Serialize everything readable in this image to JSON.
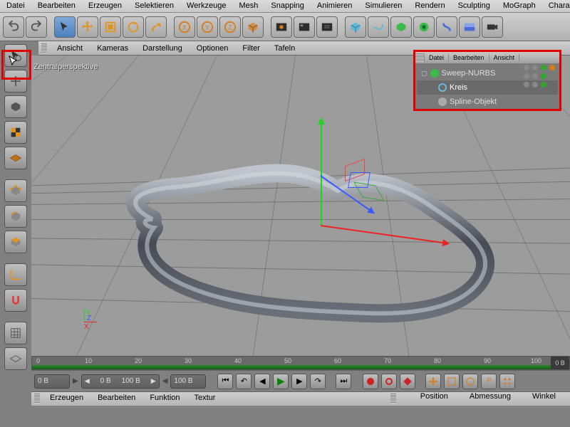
{
  "menubar": [
    "Datei",
    "Bearbeiten",
    "Erzeugen",
    "Selektieren",
    "Werkzeuge",
    "Mesh",
    "Snapping",
    "Animieren",
    "Simulieren",
    "Rendern",
    "Sculpting",
    "MoGraph",
    "Charak"
  ],
  "viewmenu": [
    "Ansicht",
    "Kameras",
    "Darstellung",
    "Optionen",
    "Filter",
    "Tafeln"
  ],
  "perspective_label": "Zentralperspektive",
  "object_panel": {
    "menus": [
      "Datei",
      "Bearbeiten",
      "Ansicht"
    ],
    "tree": {
      "root": "Sweep-NURBS",
      "children": [
        "Kreis",
        "Spline-Objekt"
      ]
    }
  },
  "timeline": {
    "ticks": [
      "0",
      "10",
      "20",
      "30",
      "40",
      "50",
      "60",
      "70",
      "80",
      "90",
      "100"
    ],
    "tail": "0 B"
  },
  "transport": {
    "start": "0 B",
    "range_a": "0 B",
    "range_b": "100 B",
    "end": "100 B"
  },
  "attr_tabs": [
    "Erzeugen",
    "Bearbeiten",
    "Funktion",
    "Textur"
  ],
  "coord_labels": {
    "pos": "Position",
    "size": "Abmessung",
    "rot": "Winkel"
  },
  "viewport_gizmo": {
    "x": "X",
    "y": "Y",
    "z": "Z"
  }
}
